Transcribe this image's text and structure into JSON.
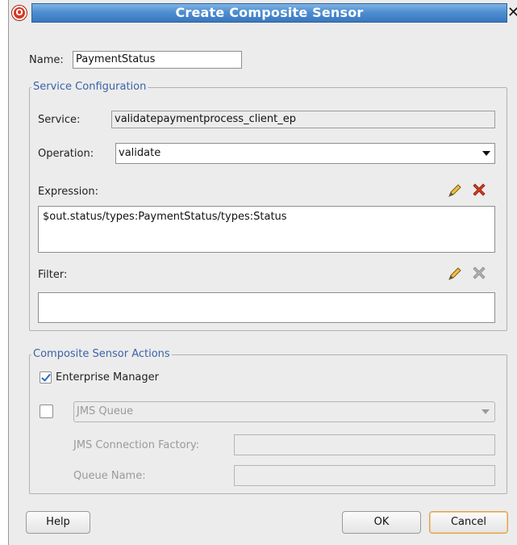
{
  "window": {
    "title": "Create Composite Sensor",
    "logo_glyph": "O",
    "close_glyph": "✕"
  },
  "name_field": {
    "label": "Name:",
    "value": "PaymentStatus"
  },
  "service_configuration": {
    "legend": "Service Configuration",
    "service": {
      "label": "Service:",
      "value": "validatepaymentprocess_client_ep"
    },
    "operation": {
      "label": "Operation:",
      "value": "validate"
    },
    "expression": {
      "label": "Expression:",
      "value": "$out.status/types:PaymentStatus/types:Status",
      "edit_icon": "pencil-icon",
      "delete_icon": "delete-x-icon"
    },
    "filter": {
      "label": "Filter:",
      "value": "",
      "edit_icon": "pencil-icon",
      "delete_icon": "delete-x-icon-disabled"
    }
  },
  "sensor_actions": {
    "legend": "Composite Sensor Actions",
    "enterprise_manager": {
      "label": "Enterprise Manager",
      "checked": true
    },
    "jms": {
      "checked": false,
      "queue_type": "JMS Queue",
      "connection_factory_label": "JMS Connection Factory:",
      "connection_factory_value": "",
      "queue_name_label": "Queue Name:",
      "queue_name_value": ""
    }
  },
  "buttons": {
    "help": "Help",
    "ok": "OK",
    "cancel": "Cancel"
  },
  "colors": {
    "title_gradient_top": "#7eb4e4",
    "title_gradient_bottom": "#3a78c0",
    "legend_text": "#3a63a8",
    "delete_active": "#d23a1c",
    "delete_disabled": "#9a9a9a",
    "checkmark": "#2c68c3"
  }
}
